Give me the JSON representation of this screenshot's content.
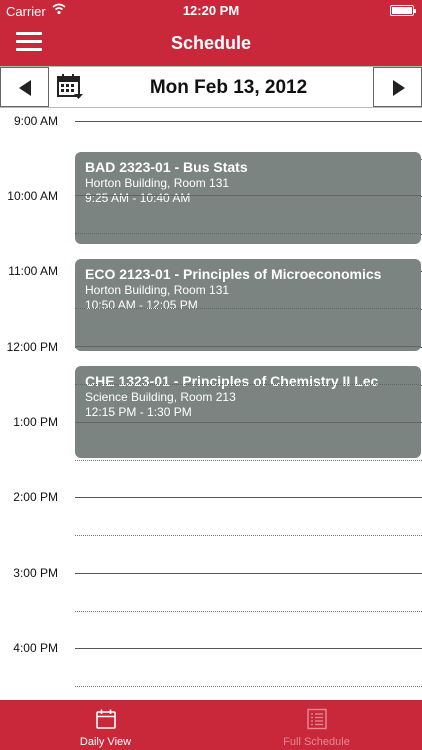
{
  "status_bar": {
    "carrier": "Carrier",
    "time": "12:20 PM"
  },
  "header": {
    "title": "Schedule"
  },
  "date_nav": {
    "date": "Mon Feb 13, 2012"
  },
  "hours": [
    "9:00 AM",
    "10:00 AM",
    "11:00 AM",
    "12:00 PM",
    "1:00 PM",
    "2:00 PM",
    "3:00 PM",
    "4:00 PM"
  ],
  "events": [
    {
      "title": "BAD 2323-01 - Bus Stats",
      "location": "Horton Building, Room 131",
      "time": "9:25 AM - 10:40 AM"
    },
    {
      "title": "ECO 2123-01 - Principles of Microeconomics",
      "location": "Horton Building, Room 131",
      "time": "10:50 AM - 12:05 PM"
    },
    {
      "title": "CHE 1323-01 - Principles of Chemistry II Lec",
      "location": "Science Building, Room 213",
      "time": "12:15 PM - 1:30 PM"
    }
  ],
  "tabs": [
    {
      "label": "Daily View",
      "icon": "calendar-icon",
      "active": true
    },
    {
      "label": "Full Schedule",
      "icon": "list-icon",
      "active": false
    }
  ],
  "colors": {
    "brand_red": "#c8283a",
    "event_gray": "#7c8482",
    "inactive_tab": "#e58a93"
  }
}
